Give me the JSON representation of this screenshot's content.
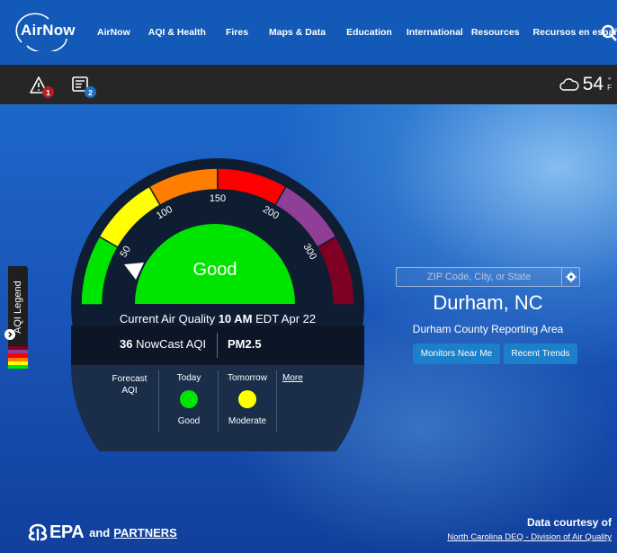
{
  "nav": {
    "logo": "AirNow",
    "links": [
      "AirNow",
      "AQI & Health",
      "Fires",
      "Maps & Data",
      "Education",
      "International",
      "Resources",
      "Recursos en español"
    ]
  },
  "toolbar": {
    "alerts_count": "1",
    "forecast_count": "2",
    "temperature": "54",
    "temp_degree": "°",
    "temp_unit": "F"
  },
  "legend": {
    "label": "AQI Legend",
    "colors": [
      "#7e0023",
      "#8f3f97",
      "#ff0000",
      "#ff7e00",
      "#ffff00",
      "#00e400"
    ]
  },
  "gauge": {
    "ticks": [
      "50",
      "100",
      "150",
      "200",
      "300"
    ],
    "segment_colors": [
      "#00e400",
      "#ffff00",
      "#ff7e00",
      "#ff0000",
      "#8f3f97",
      "#7e0023"
    ],
    "category": "Good",
    "current_label": "Current Air Quality",
    "time": "10 AM",
    "date": "EDT Apr 22",
    "aqi_value": "36",
    "aqi_label": "NowCast AQI",
    "pollutant": "PM2.5"
  },
  "forecast": {
    "label_line1": "Forecast",
    "label_line2": "AQI",
    "today": {
      "day": "Today",
      "category": "Good",
      "color": "#00e400"
    },
    "tomorrow": {
      "day": "Tomorrow",
      "category": "Moderate",
      "color": "#ffff00"
    },
    "more": "More"
  },
  "location": {
    "search_placeholder": "ZIP Code, City, or State",
    "city": "Durham, NC",
    "reporting_area": "Durham County Reporting Area",
    "monitors_button": "Monitors Near Me",
    "trends_button": "Recent Trends"
  },
  "footer": {
    "epa": "EPA",
    "and": "and",
    "partners": "PARTNERS",
    "courtesy": "Data courtesy of",
    "courtesy_link": "North Carolina DEQ - Division of Air Quality"
  }
}
